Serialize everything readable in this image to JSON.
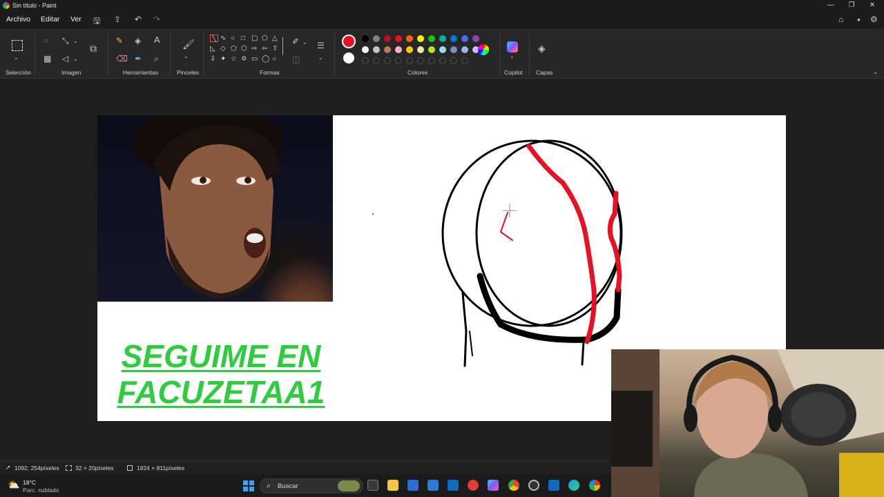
{
  "window": {
    "title": "Sin título - Paint"
  },
  "menu": {
    "file": "Archivo",
    "edit": "Editar",
    "view": "Ver"
  },
  "ribbon": {
    "groups": {
      "selection": "Selección",
      "image": "Imagen",
      "tools": "Herramientas",
      "brushes": "Pinceles",
      "shapes": "Formas",
      "colors": "Colores",
      "copilot": "Copilot",
      "layers": "Capas"
    },
    "tools": {
      "text_tool": "A"
    },
    "active_color": "#e81123",
    "secondary_color": "#ffffff",
    "palette_row1": [
      "#000000",
      "#7f7f7f",
      "#c00d1e",
      "#e81123",
      "#f7630c",
      "#fff100",
      "#16c60c",
      "#00b294",
      "#0078d7",
      "#4f6bed",
      "#8e44ad"
    ],
    "palette_row2": [
      "#ffffff",
      "#c3c3c3",
      "#b97a57",
      "#ffaec9",
      "#ffc90e",
      "#efe4b0",
      "#b5e61d",
      "#99d9ea",
      "#7092be",
      "#9ab7e6",
      "#c8bfe7"
    ]
  },
  "canvas": {
    "promo_line1": "SEGUIME EN",
    "promo_line2": "FACUZETAA1",
    "promo_color": "#2fcc40",
    "stroke_color": "#000000",
    "accent_stroke_color": "#e81123"
  },
  "status": {
    "cursor_position": "1092, 254píxeles",
    "selection_size": "32 × 20píxeles",
    "canvas_size": "1824 × 811píxeles"
  },
  "taskbar": {
    "weather_temp": "18°C",
    "weather_desc": "Parc. nublado",
    "search_placeholder": "Buscar"
  }
}
